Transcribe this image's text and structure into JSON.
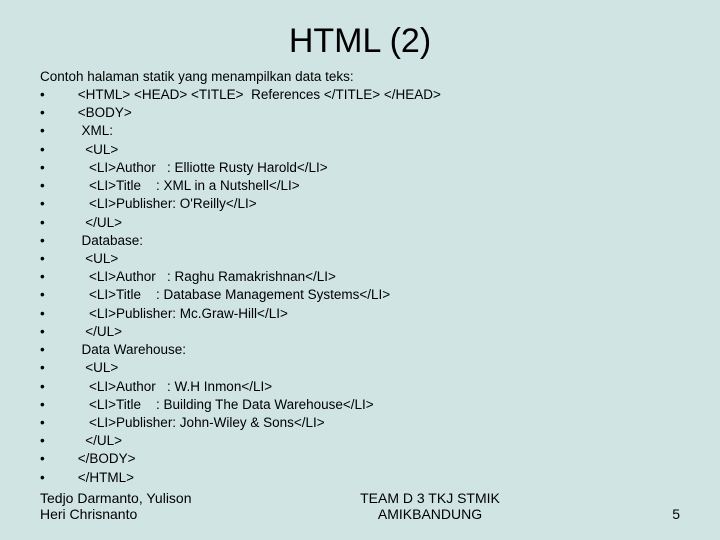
{
  "title": "HTML  (2)",
  "intro": "Contoh halaman statik yang menampilkan data teks:",
  "lines": [
    " <HTML> <HEAD> <TITLE>  References </TITLE> </HEAD>",
    " <BODY>",
    "  XML:",
    "   <UL>",
    "    <LI>Author   : Elliotte Rusty Harold</LI>",
    "    <LI>Title    : XML in a Nutshell</LI>",
    "    <LI>Publisher: O'Reilly</LI>",
    "   </UL>",
    "  Database:",
    "   <UL>",
    "    <LI>Author   : Raghu Ramakrishnan</LI>",
    "    <LI>Title    : Database Management Systems</LI>",
    "    <LI>Publisher: Mc.Graw-Hill</LI>",
    "   </UL>",
    "  Data Warehouse:",
    "   <UL>",
    "    <LI>Author   : W.H Inmon</LI>",
    "    <LI>Title    : Building The Data Warehouse</LI>",
    "    <LI>Publisher: John-Wiley & Sons</LI>",
    "   </UL>",
    " </BODY>",
    " </HTML>"
  ],
  "footer": {
    "left_line1": "Tedjo Darmanto, Yulison",
    "left_line2": "Heri Chrisnanto",
    "center_line1": "TEAM D 3 TKJ STMIK",
    "center_line2": "AMIKBANDUNG",
    "page": "5"
  }
}
